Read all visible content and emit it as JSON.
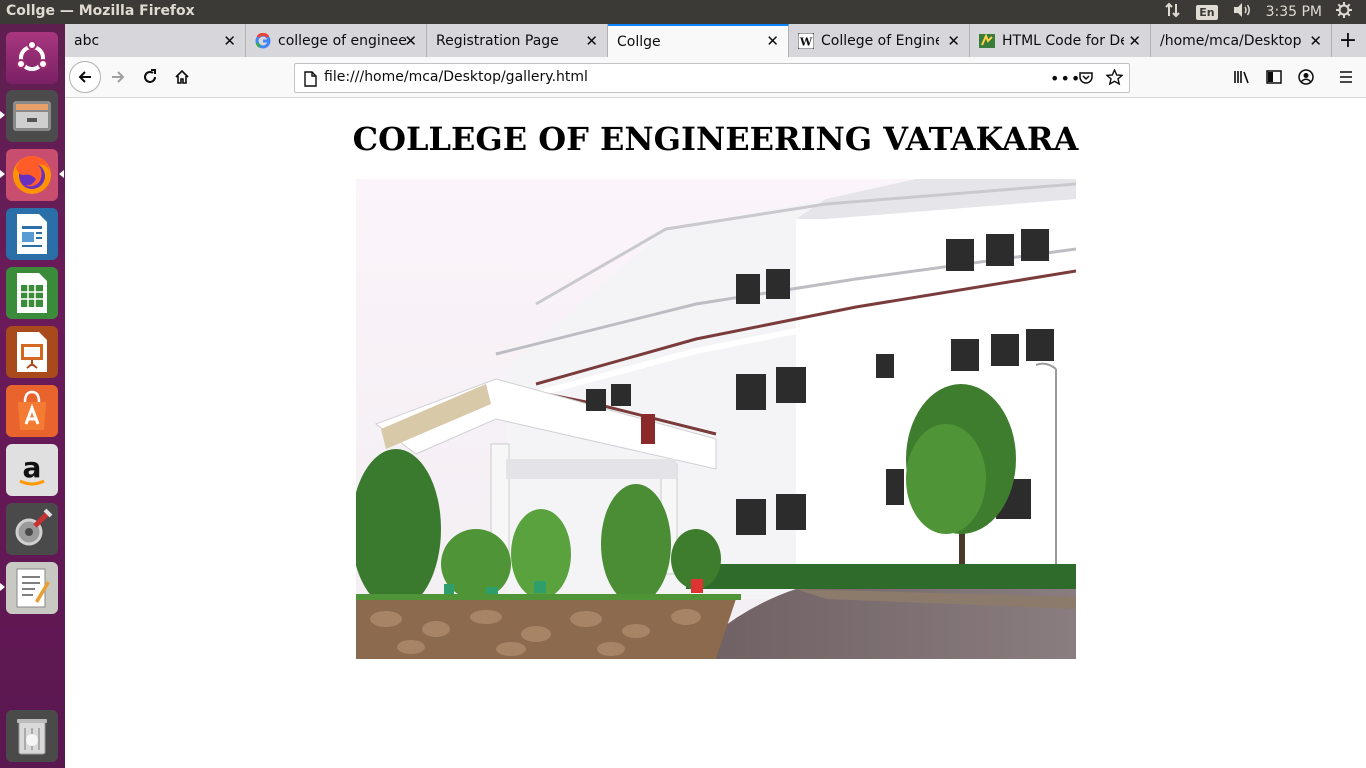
{
  "window": {
    "title": "Collge — Mozilla Firefox"
  },
  "tray": {
    "keyboard_layout": "En",
    "clock": "3:35 PM"
  },
  "tabs": [
    {
      "label": "abc",
      "favicon": "none",
      "active": false
    },
    {
      "label": "college of enginee",
      "favicon": "google-icon",
      "active": false
    },
    {
      "label": "Registration Page",
      "favicon": "none",
      "active": false
    },
    {
      "label": "Collge",
      "favicon": "none",
      "active": true
    },
    {
      "label": "College of Engine",
      "favicon": "wikipedia-icon",
      "active": false
    },
    {
      "label": "HTML Code for De",
      "favicon": "html-code-icon",
      "active": false
    },
    {
      "label": "/home/mca/Desktop",
      "favicon": "none",
      "active": false
    }
  ],
  "address_bar": {
    "url": "file:///home/mca/Desktop/gallery.html"
  },
  "page": {
    "heading": "COLLEGE OF ENGINEERING VATAKARA",
    "image": "college-building-photo"
  },
  "launcher": {
    "items": [
      "ubuntu-dash-icon",
      "files-icon",
      "firefox-icon",
      "writer-icon",
      "calc-icon",
      "impress-icon",
      "software-center-icon",
      "amazon-icon",
      "system-settings-icon",
      "text-editor-icon",
      "trash-icon"
    ]
  },
  "colors": {
    "accent": "#0a84ff",
    "launcher": "#5e1f4f",
    "topbar": "#3b3a36"
  }
}
